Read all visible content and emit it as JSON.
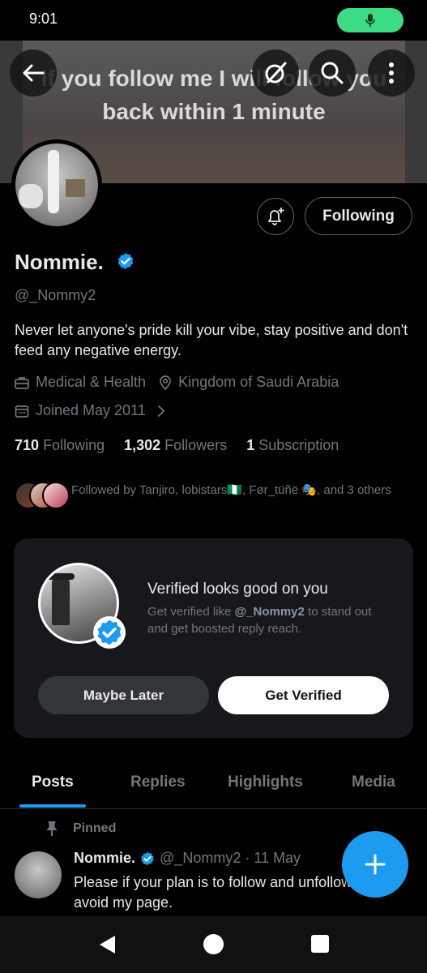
{
  "status_bar": {
    "time": "9:01"
  },
  "banner": {
    "text": "If you follow me I will follow you back within 1 minute"
  },
  "profile": {
    "name": "Nommie.",
    "handle": "@_Nommy2",
    "bio": "Never let anyone's pride kill your vibe, stay positive and don't feed any negative energy.",
    "category": "Medical & Health",
    "location": "Kingdom of Saudi Arabia",
    "joined": "Joined May 2011",
    "following_button": "Following",
    "stats": {
      "following_count": "710",
      "following_label": "Following",
      "followers_count": "1,302",
      "followers_label": "Followers",
      "subscription_count": "1",
      "subscription_label": "Subscription"
    },
    "followed_by": "Followed by Tanjiro, lobistars🇳🇬, Før_tüñë 🎭, and 3 others"
  },
  "verify_card": {
    "title": "Verified looks good on you",
    "desc_prefix": "Get verified like ",
    "desc_handle": "@_Nommy2",
    "desc_suffix": " to stand out and get boosted reply reach.",
    "later_button": "Maybe Later",
    "verify_button": "Get Verified"
  },
  "tabs": [
    "Posts",
    "Replies",
    "Highlights",
    "Media"
  ],
  "pinned_post": {
    "pinned_label": "Pinned",
    "author": "Nommie.",
    "handle": "@_Nommy2",
    "date": "· 11 May",
    "text": "Please if your plan is to follow and unfollow, kindly avoid my page."
  },
  "colors": {
    "accent": "#1d9bf0",
    "background": "#000000",
    "card": "#16181c",
    "muted_text": "#71767b"
  },
  "icons": [
    "back-arrow-icon",
    "grok-icon",
    "search-icon",
    "more-vertical-icon",
    "bell-plus-icon",
    "verified-badge-icon",
    "briefcase-icon",
    "location-pin-icon",
    "calendar-icon",
    "chevron-right-icon",
    "pin-icon",
    "plus-icon",
    "mic-icon"
  ]
}
